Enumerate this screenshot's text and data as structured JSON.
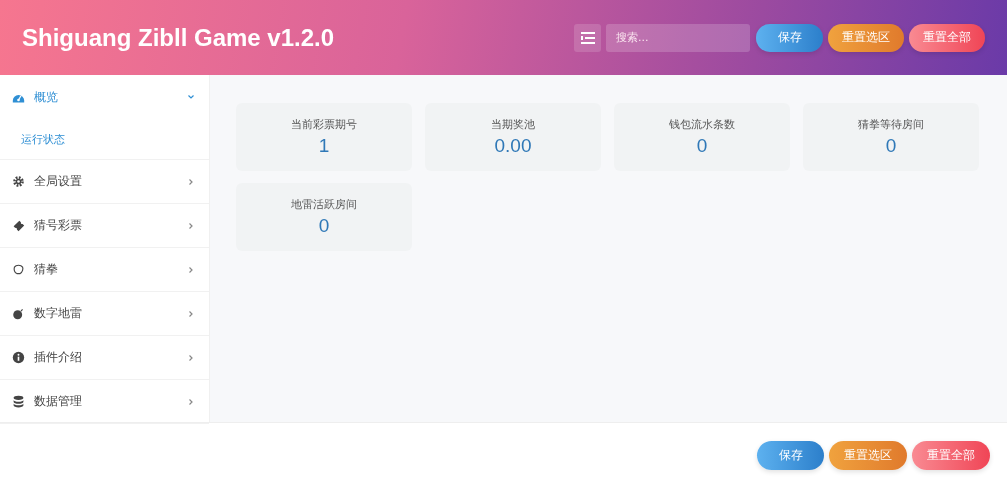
{
  "header": {
    "title": "Shiguang Zibll Game v1.2.0",
    "search": {
      "placeholder": "搜索..."
    },
    "buttons": [
      {
        "label": "保存",
        "kind": "save"
      },
      {
        "label": "重置选区",
        "kind": "reset_selection"
      },
      {
        "label": "重置全部",
        "kind": "reset_all"
      }
    ]
  },
  "sidebar": {
    "items": [
      {
        "label": "概览",
        "expanded": true,
        "selected": true,
        "children": [
          {
            "label": "运行状态",
            "selected": true
          }
        ]
      },
      {
        "label": "全局设置",
        "expanded": false,
        "selected": false
      },
      {
        "label": "猜号彩票",
        "expanded": false,
        "selected": false
      },
      {
        "label": "猜拳",
        "expanded": false,
        "selected": false
      },
      {
        "label": "数字地雷",
        "expanded": false,
        "selected": false
      },
      {
        "label": "插件介绍",
        "expanded": false,
        "selected": false
      },
      {
        "label": "数据管理",
        "expanded": false,
        "selected": false
      }
    ]
  },
  "stats": [
    {
      "label": "当前彩票期号",
      "value": "1"
    },
    {
      "label": "当期奖池",
      "value": "0.00"
    },
    {
      "label": "钱包流水条数",
      "value": "0"
    },
    {
      "label": "猜拳等待房间",
      "value": "0"
    },
    {
      "label": "地雷活跃房间",
      "value": "0"
    }
  ],
  "footer": {
    "buttons": [
      {
        "label": "保存",
        "kind": "save"
      },
      {
        "label": "重置选区",
        "kind": "reset_selection"
      },
      {
        "label": "重置全部",
        "kind": "reset_all"
      }
    ]
  }
}
